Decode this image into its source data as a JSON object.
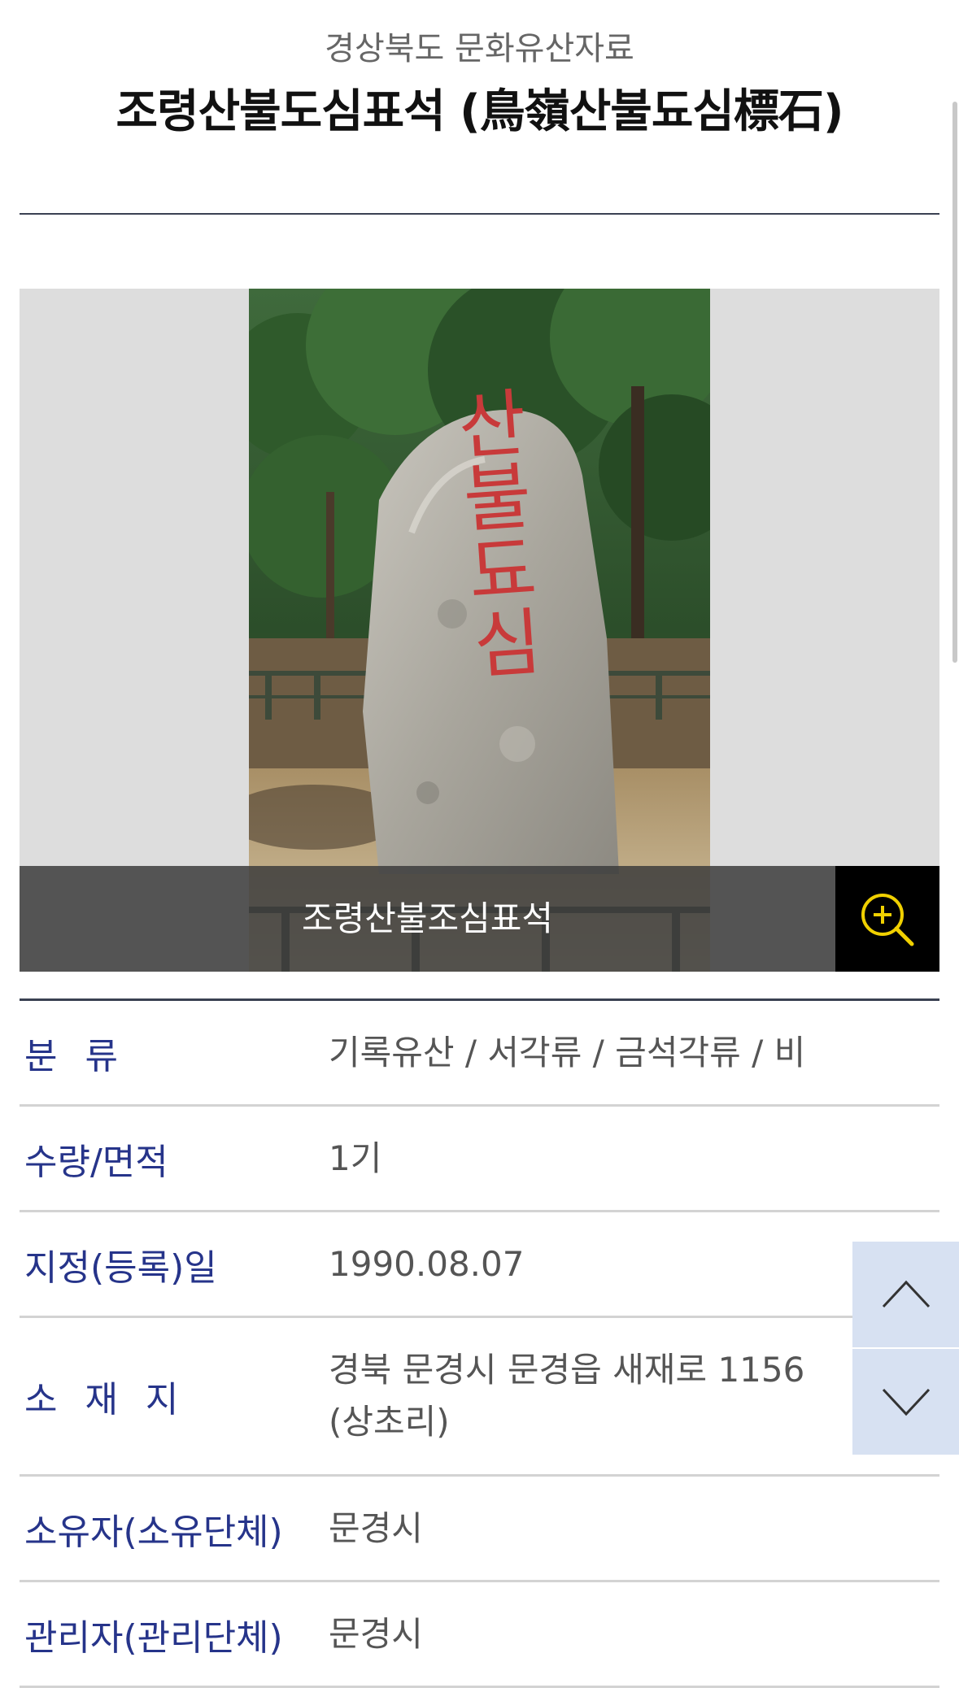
{
  "header": {
    "category": "경상북도 문화유산자료",
    "title": "조령산불도심표석 (鳥嶺산불됴심標石)"
  },
  "gallery": {
    "caption": "조령산불조심표석",
    "photo_inscription": "산불됴심",
    "zoom_icon": "zoom-in-icon"
  },
  "details": [
    {
      "label": "분 류",
      "value": "기록유산 / 서각류 / 금석각류 / 비"
    },
    {
      "label": "수량/면적",
      "value": "1기"
    },
    {
      "label": "지정(등록)일",
      "value": "1990.08.07"
    },
    {
      "label": "소 재 지",
      "value": "경북 문경시 문경읍 새재로 1156 (상초리)"
    },
    {
      "label": "소유자(소유단체)",
      "value": "문경시"
    },
    {
      "label": "관리자(관리단체)",
      "value": "문경시"
    }
  ],
  "nav": {
    "up_icon": "chevron-up-icon",
    "down_icon": "chevron-down-icon"
  },
  "colors": {
    "label": "#26348a",
    "zoom_icon": "#f0d000",
    "scroll_button_bg": "#d7e1f2"
  }
}
